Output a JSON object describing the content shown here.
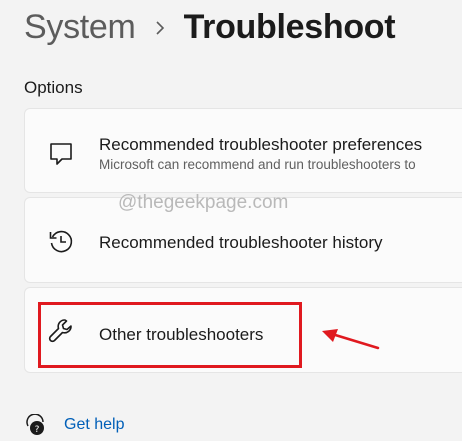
{
  "breadcrumb": {
    "parent": "System",
    "current": "Troubleshoot"
  },
  "section": {
    "label": "Options"
  },
  "cards": {
    "preferences": {
      "title": "Recommended troubleshooter preferences",
      "subtitle": "Microsoft can recommend and run troubleshooters to",
      "icon": "chat-bubble-icon"
    },
    "history": {
      "title": "Recommended troubleshooter history",
      "icon": "history-icon"
    },
    "other": {
      "title": "Other troubleshooters",
      "icon": "wrench-icon"
    }
  },
  "watermark": "@thegeekpage.com",
  "help": {
    "label": "Get help",
    "icon": "help-icon"
  },
  "colors": {
    "background": "#f3f3f3",
    "card": "#fbfbfb",
    "annotation": "#e0191f",
    "link": "#005fb8"
  }
}
